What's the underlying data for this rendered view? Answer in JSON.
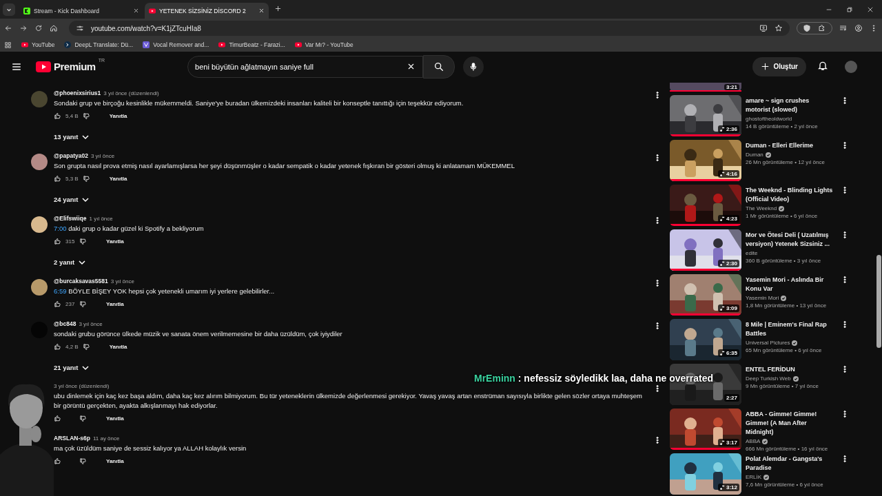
{
  "browser": {
    "tabs": [
      {
        "title": "Stream - Kick Dashboard",
        "selected": false,
        "kind": "kick"
      },
      {
        "title": "YETENEK SİZSİNİZ DİSCORD 2",
        "selected": true,
        "kind": "youtube"
      }
    ],
    "url": "youtube.com/watch?v=K1jZTcuHIa8",
    "bookmarks": [
      {
        "label": "YouTube",
        "kind": "youtube"
      },
      {
        "label": "DeepL Translate: Dü...",
        "kind": "deepl"
      },
      {
        "label": "Vocal Remover and...",
        "kind": "vocal"
      },
      {
        "label": "TimurBeatz - Farazi...",
        "kind": "youtube"
      },
      {
        "label": "Var Mı? - YouTube",
        "kind": "youtube"
      }
    ]
  },
  "masthead": {
    "logo_text": "Premium",
    "region": "TR",
    "search": "beni büyütün ağlatmayın saniye full",
    "create_label": "Oluştur"
  },
  "comments": [
    {
      "author": "@phoenixsirius1",
      "time": "3 yıl önce (düzenlendi)",
      "text": "Sondaki grup ve birçoğu kesinlikle mükemmeldi. Saniye'ye buradan ülkemizdeki insanları kaliteli bir konseptle tanıttığı için teşekkür ediyorum.",
      "likes": "5,4 B",
      "reply_label": "Yanıtla",
      "replies": "13 yanıt",
      "color": "#4a4630"
    },
    {
      "author": "@papatya02",
      "time": "3 yıl önce",
      "text": "Son grupta nasıl prova etmiş nasıl ayarlamışlarsa her şeyi düşünmüşler o kadar sempatik o kadar yetenek fışkıran bir gösteri olmuş ki anlatamam MÜKEMMEL",
      "likes": "5,3 B",
      "reply_label": "Yanıtla",
      "replies": "24 yanıt",
      "color": "#b48a86"
    },
    {
      "author": "@Elifswiiqe",
      "time": "1 yıl önce",
      "timestamp": "7:00",
      "text": "daki grup o kadar güzel ki Spotify a bekliyorum",
      "likes": "315",
      "reply_label": "Yanıtla",
      "replies": "2 yanıt",
      "color": "#d8b98e"
    },
    {
      "author": "@burcaksavas5581",
      "time": "3 yıl önce",
      "timestamp": "6:59",
      "text": "BÖYLE BİŞEY YOK hepsi çok yetenekli umarım iyi yerlere gelebilirler...",
      "likes": "237",
      "reply_label": "Yanıtla",
      "color": "#b89a6a"
    },
    {
      "author": "@bc848",
      "time": "3 yıl önce",
      "text": "sondaki grubu görünce ülkede müzik ve sanata önem verilmemesine bir daha üzüldüm, çok iyiydiler",
      "likes": "4,2 B",
      "reply_label": "Yanıtla",
      "replies": "21 yanıt",
      "color": "#050505"
    },
    {
      "time": "3 yıl önce (düzenlendi)",
      "text": "ubu dinlemek için kaç kez başa aldım, daha kaç kez alırım bilmiyorum. Bu tür yeteneklerin ülkemizde değerlenmesi gerekiyor. Yavaş yavaş artan enstrüman sayısıyla birlikte gelen sözler ortaya muhteşem bir görüntü gerçekten, ayakta alkışlanmayı hak ediyorlar.",
      "reply_label": "Yanıtla"
    },
    {
      "author": "ARSLAN-s6p",
      "time": "11 ay önce",
      "text": "ma çok üzüldüm saniye de sessiz kalıyor ya ALLAH kolaylık versin",
      "reply_label": "Yanıtla"
    }
  ],
  "sidebar": {
    "top_clip_duration": "3:21",
    "videos": [
      {
        "title": "amare ~ sign crushes motorist (slowed)",
        "channel": "ghostoftheoldworld",
        "verified": false,
        "meta": "14 B görüntüleme • 2 yıl önce",
        "duration": "2:36",
        "music": true,
        "watched": true
      },
      {
        "title": "Duman - Elleri Ellerime",
        "channel": "Duman",
        "verified": true,
        "meta": "26 Mn görüntüleme • 12 yıl önce",
        "duration": "4:16",
        "music": true,
        "watched": true
      },
      {
        "title": "The Weeknd - Blinding Lights (Official Video)",
        "channel": "The Weeknd",
        "verified": true,
        "meta": "1 Mr görüntüleme • 6 yıl önce",
        "duration": "4:23",
        "music": true,
        "watched": true
      },
      {
        "title": "Mor ve Ötesi Deli ( Uzatılmış versiyon) Yetenek Sizsiniz ...",
        "channel": "edite",
        "verified": false,
        "meta": "360 B görüntüleme • 3 yıl önce",
        "duration": "2:30",
        "music": true,
        "watched": true
      },
      {
        "title": "Yasemin Mori - Aslında Bir Konu Var",
        "channel": "Yasemin Mori",
        "verified": true,
        "meta": "1,8 Mn görüntüleme • 13 yıl önce",
        "duration": "3:09",
        "music": true,
        "watched": true
      },
      {
        "title": "8 Mile | Eminem's Final Rap Battles",
        "channel": "Universal Pictures",
        "verified": true,
        "meta": "65 Mn görüntüleme • 6 yıl önce",
        "duration": "6:35",
        "music": true,
        "watched": false
      },
      {
        "title": "ENTEL FERİDUN",
        "channel": "Deep Turkish Web",
        "verified": true,
        "meta": "9 Mn görüntüleme • 7 yıl önce",
        "duration": "2:27",
        "music": false,
        "watched": false
      },
      {
        "title": "ABBA - Gimme! Gimme! Gimme! (A Man After Midnight)",
        "channel": "ABBA",
        "verified": true,
        "meta": "666 Mn görüntüleme • 16 yıl önce",
        "duration": "3:17",
        "music": true,
        "watched": true
      },
      {
        "title": "Polat Alemdar - Gangsta's Paradise",
        "channel": "ERLİK",
        "verified": true,
        "meta": "7,6 Mn görüntüleme • 6 yıl önce",
        "duration": "3:12",
        "music": true,
        "watched": false
      }
    ]
  },
  "overlay": {
    "chat_user": "MrEminn",
    "chat_message": ": nefessiz söyledikk laa, daha ne overrated"
  }
}
